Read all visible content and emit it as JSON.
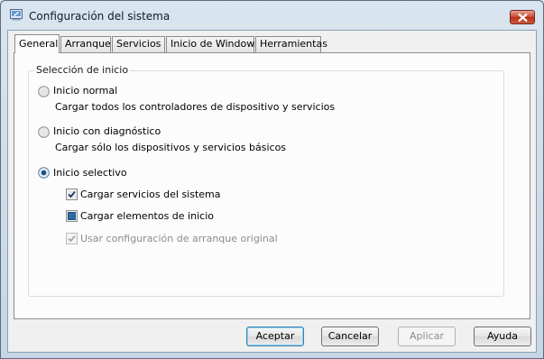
{
  "window": {
    "title": "Configuración del sistema",
    "icon": "system-config-icon"
  },
  "tabs": [
    {
      "label": "General",
      "active": true
    },
    {
      "label": "Arranque",
      "active": false
    },
    {
      "label": "Servicios",
      "active": false
    },
    {
      "label": "Inicio de Windows",
      "active": false
    },
    {
      "label": "Herramientas",
      "active": false
    }
  ],
  "startup_group": {
    "label": "Selección de inicio",
    "normal": {
      "label": "Inicio normal",
      "description": "Cargar todos los controladores de dispositivo y servicios",
      "selected": false
    },
    "diagnostic": {
      "label": "Inicio con diagnóstico",
      "description": "Cargar sólo los dispositivos y servicios básicos",
      "selected": false
    },
    "selective": {
      "label": "Inicio selectivo",
      "selected": true,
      "options": {
        "system_services": {
          "label": "Cargar servicios del sistema",
          "state": "checked"
        },
        "startup_items": {
          "label": "Cargar elementos de inicio",
          "state": "indeterminate"
        },
        "original_boot": {
          "label": "Usar configuración de arranque original",
          "state": "checked-disabled"
        }
      }
    }
  },
  "buttons": {
    "accept": "Aceptar",
    "cancel": "Cancelar",
    "apply": "Aplicar",
    "help": "Ayuda"
  },
  "colors": {
    "accent": "#3c7fb1",
    "close": "#c9462c",
    "indeterminate": "#2d6da3"
  }
}
